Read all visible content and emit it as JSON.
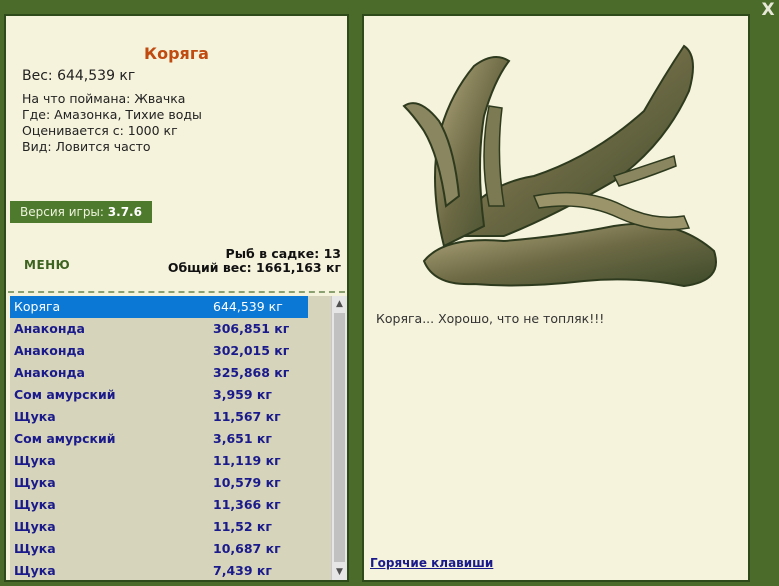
{
  "item": {
    "title": "Коряга",
    "weight": "Вес: 644,539 кг",
    "caught_on": "На что поймана: Жвачка",
    "location": "Где: Амазонка, Тихие воды",
    "valued_from": "Оценивается с: 1000 кг",
    "view": "Вид: Ловится часто"
  },
  "version": {
    "label": "Версия игры:",
    "number": "3.7.6"
  },
  "menu_label": "МЕНЮ",
  "stats": {
    "fish_in_cage": "Рыб в садке: 13",
    "total_weight": "Общий вес: 1661,163 кг"
  },
  "catch_list": [
    {
      "name": "Коряга",
      "weight": "644,539 кг",
      "selected": true
    },
    {
      "name": "Анаконда",
      "weight": "306,851 кг"
    },
    {
      "name": "Анаконда",
      "weight": "302,015 кг"
    },
    {
      "name": "Анаконда",
      "weight": "325,868 кг"
    },
    {
      "name": "Сом амурский",
      "weight": "3,959 кг"
    },
    {
      "name": "Щука",
      "weight": "11,567 кг"
    },
    {
      "name": "Сом амурский",
      "weight": "3,651 кг"
    },
    {
      "name": "Щука",
      "weight": "11,119 кг"
    },
    {
      "name": "Щука",
      "weight": "10,579 кг"
    },
    {
      "name": "Щука",
      "weight": "11,366 кг"
    },
    {
      "name": "Щука",
      "weight": "11,52 кг"
    },
    {
      "name": "Щука",
      "weight": "10,687 кг"
    },
    {
      "name": "Щука",
      "weight": "7,439 кг"
    }
  ],
  "caption": "Коряга... Хорошо, что не топляк!!!",
  "hotkeys_label": "Горячие клавиши",
  "close_label": "X",
  "image_icon": "driftwood-image",
  "colors": {
    "background": "#4a6b2a",
    "panel": "#f5f3dc",
    "title": "#c04a10",
    "list_text": "#1a1a8c",
    "selected": "#0a78d4"
  }
}
